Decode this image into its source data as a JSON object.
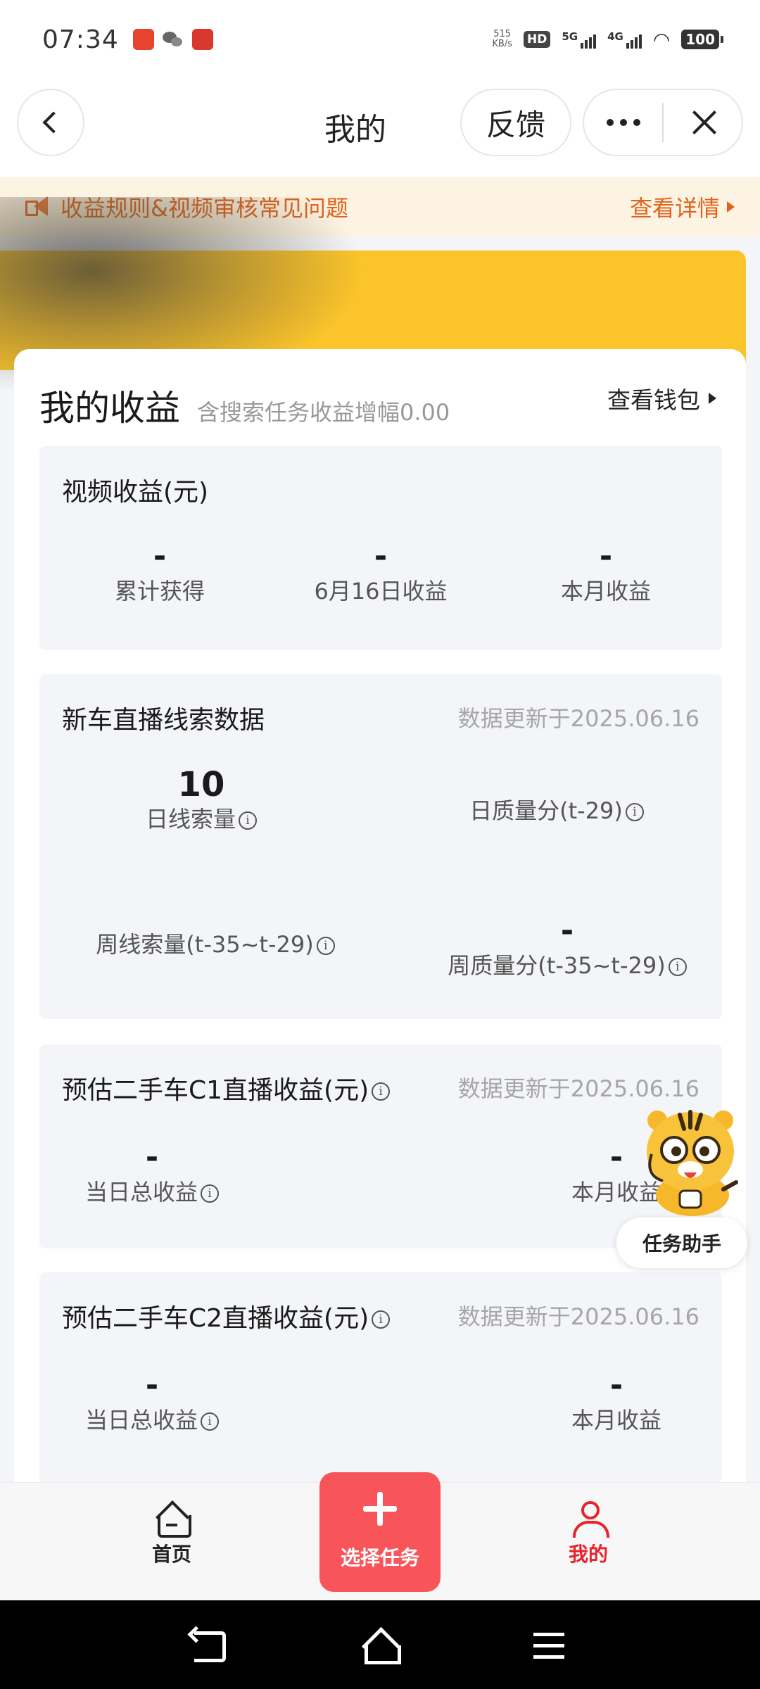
{
  "status_bar": {
    "time": "07:34",
    "net_speed_value": "515",
    "net_speed_unit": "KB/s",
    "hd_label": "HD",
    "signal_5g": "5G",
    "signal_4g": "4G",
    "battery": "100"
  },
  "nav": {
    "title": "我的",
    "feedback_label": "反馈"
  },
  "notice": {
    "text": "收益规则&视频审核常见问题",
    "link": "查看详情"
  },
  "earnings": {
    "title": "我的收益",
    "subtitle": "含搜索任务收益增幅0.00",
    "wallet_link": "查看钱包"
  },
  "video_income": {
    "title": "视频收益(元)",
    "stats": [
      {
        "value": "-",
        "label": "累计获得"
      },
      {
        "value": "-",
        "label": "6月16日收益"
      },
      {
        "value": "-",
        "label": "本月收益"
      }
    ]
  },
  "live_leads": {
    "title": "新车直播线索数据",
    "updated": "数据更新于2025.06.16",
    "daily_leads_value": "10",
    "daily_leads_label": "日线索量",
    "daily_quality_label": "日质量分(t-29)",
    "weekly_leads_label": "周线索量(t-35~t-29)",
    "weekly_quality_value": "-",
    "weekly_quality_label": "周质量分(t-35~t-29)"
  },
  "c1_income": {
    "title": "预估二手车C1直播收益(元)",
    "updated": "数据更新于2025.06.16",
    "daily_value": "-",
    "daily_label": "当日总收益",
    "monthly_value": "-",
    "monthly_label": "本月收益"
  },
  "c2_income": {
    "title": "预估二手车C2直播收益(元)",
    "updated": "数据更新于2025.06.16",
    "daily_value": "-",
    "daily_label": "当日总收益",
    "monthly_value": "-",
    "monthly_label": "本月收益"
  },
  "assistant": {
    "label": "任务助手"
  },
  "tabs": {
    "home": "首页",
    "select_task": "选择任务",
    "mine": "我的"
  },
  "colors": {
    "accent_red": "#e8232c",
    "task_button": "#f8555a",
    "banner_yellow": "#fbc42a",
    "notice_orange": "#e0631b"
  }
}
